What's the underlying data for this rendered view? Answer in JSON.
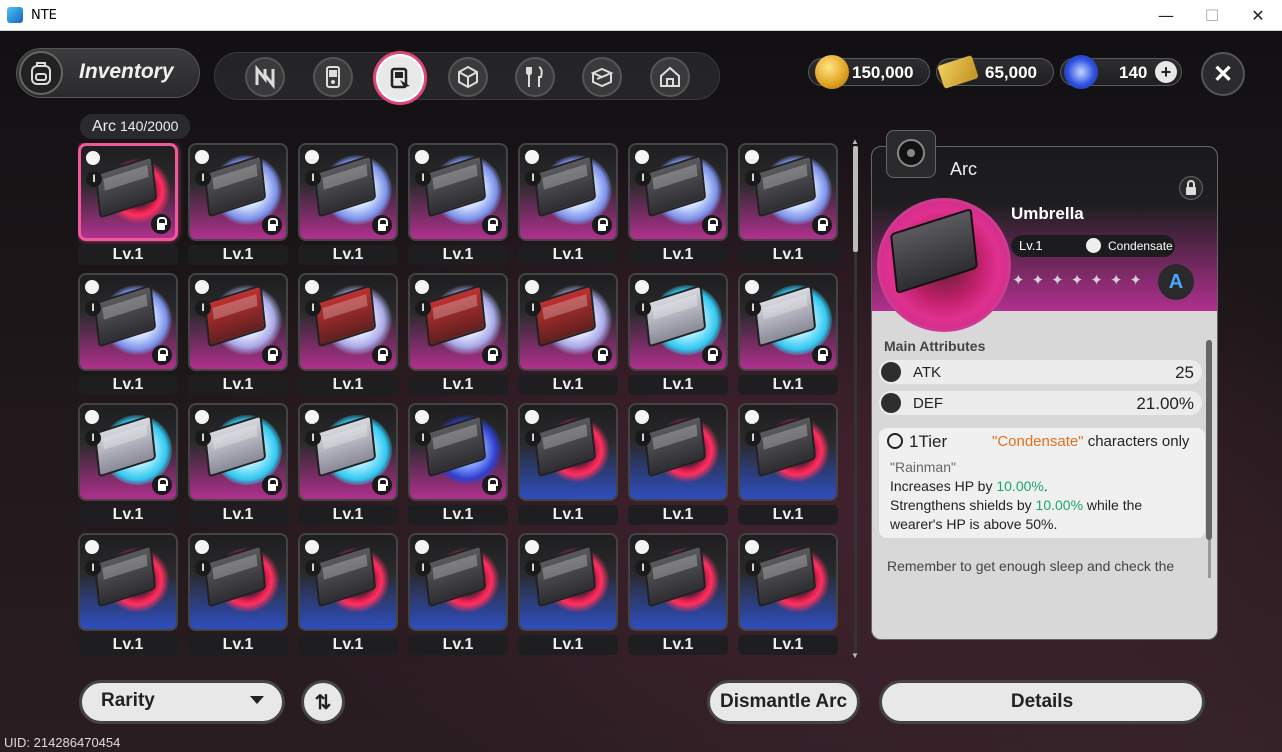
{
  "window": {
    "title": "NTE",
    "min_glyph": "—",
    "max_glyph": "☐",
    "close_glyph": "✕"
  },
  "header": {
    "title": "Inventory"
  },
  "tabs": [
    {
      "name": "tab-arcs-n",
      "icon": "n-logo-icon"
    },
    {
      "name": "tab-devices",
      "icon": "device-icon"
    },
    {
      "name": "tab-arc",
      "icon": "arc-card-icon",
      "active": true
    },
    {
      "name": "tab-materials",
      "icon": "cube-icon"
    },
    {
      "name": "tab-food",
      "icon": "fork-spoon-icon"
    },
    {
      "name": "tab-furniture",
      "icon": "box-open-icon"
    },
    {
      "name": "tab-home",
      "icon": "house-icon"
    }
  ],
  "currency": {
    "gold": "150,000",
    "tickets": "65,000",
    "crystals": "140",
    "add": "+",
    "close": "✕"
  },
  "arc_count": {
    "label": "Arc",
    "value": "140/2000"
  },
  "grid": {
    "level_label": "Lv.1",
    "tier": "I",
    "items": [
      {
        "frame": "pink",
        "orb": "red",
        "box": "grey",
        "selected": true,
        "locked": true
      },
      {
        "frame": "pink",
        "orb": "white",
        "box": "grey",
        "locked": true
      },
      {
        "frame": "pink",
        "orb": "white",
        "box": "grey",
        "locked": true
      },
      {
        "frame": "pink",
        "orb": "white",
        "box": "grey",
        "locked": true
      },
      {
        "frame": "pink",
        "orb": "white",
        "box": "grey",
        "locked": true
      },
      {
        "frame": "pink",
        "orb": "white",
        "box": "grey",
        "locked": true
      },
      {
        "frame": "pink",
        "orb": "white",
        "box": "grey",
        "locked": true
      },
      {
        "frame": "pink",
        "orb": "white",
        "box": "grey",
        "locked": true
      },
      {
        "frame": "pink",
        "orb": "swirl",
        "box": "redbox",
        "locked": true
      },
      {
        "frame": "pink",
        "orb": "swirl",
        "box": "redbox",
        "locked": true
      },
      {
        "frame": "pink",
        "orb": "swirl",
        "box": "redbox",
        "locked": true
      },
      {
        "frame": "pink",
        "orb": "swirl",
        "box": "redbox",
        "locked": true
      },
      {
        "frame": "pink",
        "orb": "cyan",
        "box": "tealbox",
        "locked": true
      },
      {
        "frame": "pink",
        "orb": "cyan",
        "box": "tealbox",
        "locked": true
      },
      {
        "frame": "pink",
        "orb": "cyan",
        "box": "tealbox",
        "locked": true
      },
      {
        "frame": "pink",
        "orb": "cyan",
        "box": "tealbox",
        "locked": true
      },
      {
        "frame": "pink",
        "orb": "cyan",
        "box": "tealbox",
        "locked": true
      },
      {
        "frame": "pink",
        "orb": "lightning",
        "box": "grey",
        "locked": true
      },
      {
        "frame": "blue",
        "orb": "red",
        "box": "grey",
        "locked": false
      },
      {
        "frame": "blue",
        "orb": "red",
        "box": "grey",
        "locked": false
      },
      {
        "frame": "blue",
        "orb": "red",
        "box": "grey",
        "locked": false
      },
      {
        "frame": "blue",
        "orb": "red",
        "box": "grey",
        "locked": false
      },
      {
        "frame": "blue",
        "orb": "red",
        "box": "grey",
        "locked": false
      },
      {
        "frame": "blue",
        "orb": "red",
        "box": "grey",
        "locked": false
      },
      {
        "frame": "blue",
        "orb": "red",
        "box": "grey",
        "locked": false
      },
      {
        "frame": "blue",
        "orb": "red",
        "box": "grey",
        "locked": false
      },
      {
        "frame": "blue",
        "orb": "red",
        "box": "grey",
        "locked": false
      },
      {
        "frame": "blue",
        "orb": "red",
        "box": "grey",
        "locked": false
      }
    ]
  },
  "detail": {
    "type": "Arc",
    "name": "Umbrella",
    "level": "Lv.1",
    "element": "Condensate",
    "stars": "✦✦✦✦✦✦✦",
    "rank": "A",
    "main_attr_title": "Main Attributes",
    "attrs": [
      {
        "label": "ATK",
        "value": "25"
      },
      {
        "label": "DEF",
        "value": "21.00%"
      }
    ],
    "tier_label": "1Tier",
    "tier_req_quote": "\"Condensate\"",
    "tier_req_rest": " characters only",
    "effect_name": "\"Rainman\"",
    "effect_1a": "Increases HP by ",
    "effect_1b": "10.00%",
    "effect_1c": ".",
    "effect_2a": "Strengthens shields by ",
    "effect_2b": "10.00%",
    "effect_2c": " while the",
    "effect_3": "wearer's HP is above 50%.",
    "flavor": "Remember to get enough sleep and check the weather forecast; remember to get your"
  },
  "bottom": {
    "rarity": "Rarity",
    "sort": "⇅",
    "dismantle": "Dismantle Arc",
    "details": "Details",
    "uid": "UID: 214286470454"
  },
  "colors": {
    "accent_pink": "#f05a9a",
    "highlight_green": "#1aa86a",
    "quote_orange": "#e07020"
  }
}
